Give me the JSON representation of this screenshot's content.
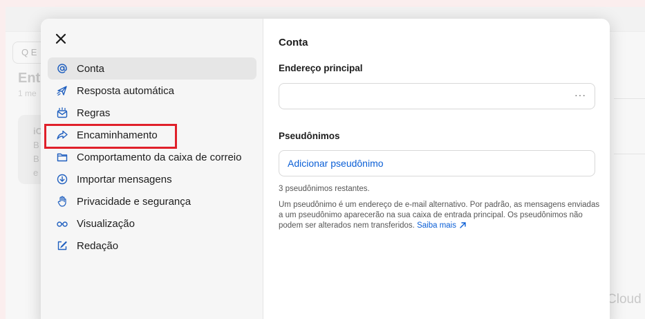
{
  "background": {
    "search_placeholder": "Q E",
    "heading": "Ent",
    "subtext": "1 me",
    "card_lines": [
      "iC",
      "B",
      "B",
      "e"
    ],
    "right_watermark": "Cloud"
  },
  "sidebar": {
    "close_icon": "close-icon",
    "items": [
      {
        "label": "Conta",
        "icon": "at-icon",
        "active": true
      },
      {
        "label": "Resposta automática",
        "icon": "paper-plane-icon",
        "active": false
      },
      {
        "label": "Regras",
        "icon": "envelope-rules-icon",
        "active": false
      },
      {
        "label": "Encaminhamento",
        "icon": "forward-arrow-icon",
        "active": false,
        "highlighted": true
      },
      {
        "label": "Comportamento da caixa de correio",
        "icon": "folder-icon",
        "active": false
      },
      {
        "label": "Importar mensagens",
        "icon": "download-circle-icon",
        "active": false
      },
      {
        "label": "Privacidade e segurança",
        "icon": "hand-icon",
        "active": false
      },
      {
        "label": "Visualização",
        "icon": "glasses-icon",
        "active": false
      },
      {
        "label": "Redação",
        "icon": "compose-icon",
        "active": false
      }
    ]
  },
  "content": {
    "title": "Conta",
    "address_label": "Endereço principal",
    "address_value": "",
    "address_menu": "···",
    "aliases_label": "Pseudônimos",
    "add_alias_label": "Adicionar pseudônimo",
    "remaining_text": "3 pseudônimos restantes.",
    "description": "Um pseudônimo é um endereço de e-mail alternativo. Por padrão, as mensagens enviadas a um pseudônimo aparecerão na sua caixa de entrada principal. Os pseudônimos não podem ser alterados nem transferidos.",
    "learn_more": "Saiba mais"
  },
  "colors": {
    "accent": "#0b5fd6",
    "highlight_box": "#e0202a",
    "active_item": "#e6e6e6",
    "icon_blue": "#1f5fbf"
  }
}
